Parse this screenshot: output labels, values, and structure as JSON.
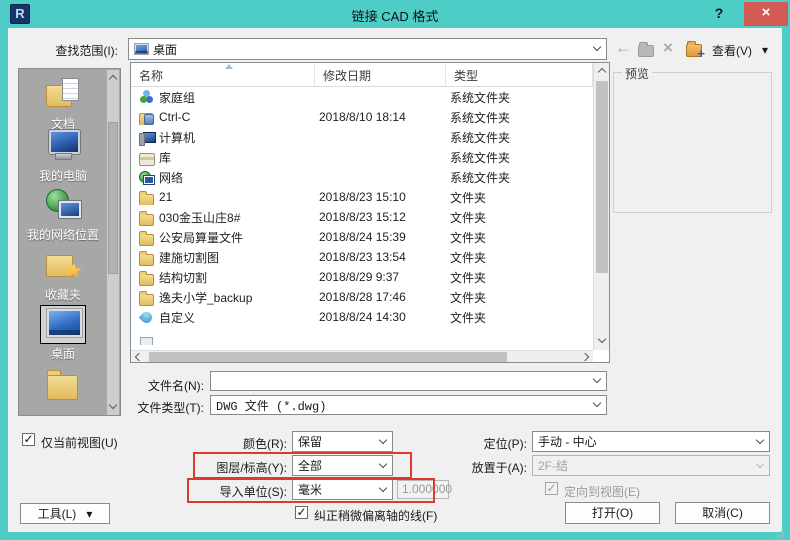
{
  "window": {
    "title": "链接 CAD 格式",
    "help_label": "?"
  },
  "icons": {
    "app_glyph": "R",
    "close": "×",
    "back": "←",
    "delete": "×",
    "plus": "+",
    "view_arrow": "▾",
    "tools_arrow": "▾",
    "check": "✓"
  },
  "toolbar": {
    "look_in_label": "查找范围(I):",
    "look_in_value": "桌面",
    "view_label": "查看(V)"
  },
  "sidebar": {
    "items": [
      {
        "label": "文档",
        "icon": "doc-large"
      },
      {
        "label": "我的电脑",
        "icon": "computer-large"
      },
      {
        "label": "我的网络位置",
        "icon": "network-large"
      },
      {
        "label": "收藏夹",
        "icon": "favorites-large"
      },
      {
        "label": "桌面",
        "icon": "desktop-large",
        "selected": true
      },
      {
        "label": "",
        "icon": "folder-large"
      }
    ]
  },
  "list": {
    "columns": {
      "name": "名称",
      "date": "修改日期",
      "type": "类型"
    },
    "rows": [
      {
        "name": "家庭组",
        "date": "",
        "type": "系统文件夹",
        "icon": "homegroup"
      },
      {
        "name": "Ctrl-C",
        "date": "2018/8/10 18:14",
        "type": "系统文件夹",
        "icon": "user-folder"
      },
      {
        "name": "计算机",
        "date": "",
        "type": "系统文件夹",
        "icon": "computer"
      },
      {
        "name": "库",
        "date": "",
        "type": "系统文件夹",
        "icon": "libraries"
      },
      {
        "name": "网络",
        "date": "",
        "type": "系统文件夹",
        "icon": "network"
      },
      {
        "name": "21",
        "date": "2018/8/23 15:10",
        "type": "文件夹",
        "icon": "folder"
      },
      {
        "name": "030金玉山庄8#",
        "date": "2018/8/23 15:12",
        "type": "文件夹",
        "icon": "folder"
      },
      {
        "name": "公安局算量文件",
        "date": "2018/8/24 15:39",
        "type": "文件夹",
        "icon": "folder"
      },
      {
        "name": "建施切割图",
        "date": "2018/8/23 13:54",
        "type": "文件夹",
        "icon": "folder"
      },
      {
        "name": "结构切割",
        "date": "2018/8/29 9:37",
        "type": "文件夹",
        "icon": "folder"
      },
      {
        "name": "逸夫小学_backup",
        "date": "2018/8/28 17:46",
        "type": "文件夹",
        "icon": "folder"
      },
      {
        "name": "自定义",
        "date": "2018/8/24 14:30",
        "type": "文件夹",
        "icon": "custom"
      }
    ]
  },
  "preview": {
    "label": "预览"
  },
  "fields": {
    "file_name_label": "文件名(N):",
    "file_name_value": "",
    "file_type_label": "文件类型(T):",
    "file_type_value": "DWG 文件 (*.dwg)"
  },
  "options": {
    "current_view_label": "仅当前视图(U)",
    "current_view_checked": true,
    "colors_label": "颜色(R):",
    "colors_value": "保留",
    "layers_label": "图层/标高(Y):",
    "layers_value": "全部",
    "units_label": "导入单位(S):",
    "units_value": "毫米",
    "scale_value": "1.000000",
    "positioning_label": "定位(P):",
    "positioning_value": "手动 - 中心",
    "place_at_label": "放置于(A):",
    "place_at_value": "2F-结",
    "orient_label": "定向到视图(E)",
    "orient_checked": true,
    "correct_lines_label": "纠正稍微偏离轴的线(F)",
    "correct_lines_checked": true,
    "tools_label": "工具(L)"
  },
  "buttons": {
    "open": "打开(O)",
    "cancel": "取消(C)"
  },
  "colors": {
    "titlebar": "#4ecdc6",
    "close_button": "#d25b56",
    "annotation_box": "#e0382c",
    "folder_icon": "#e3bb5e"
  }
}
